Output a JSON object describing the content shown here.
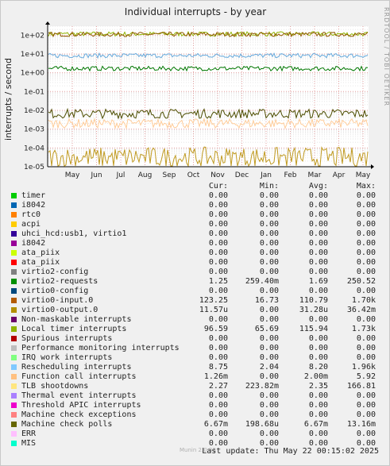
{
  "window": {
    "title": "Individual interrupts - by year"
  },
  "side_label": "RRDTOOL / TOBI OETIKER",
  "chart_data": {
    "type": "line",
    "title": "Individual interrupts - by year",
    "ylabel": "interrupts / second",
    "yscale": "log",
    "ylim": [
      1e-05,
      300
    ],
    "yticks": [
      "1e+02",
      "1e+01",
      "1e+00",
      "1e-01",
      "1e-02",
      "1e-03",
      "1e-04",
      "1e-05"
    ],
    "xticks": [
      "May",
      "Jun",
      "Jul",
      "Aug",
      "Sep",
      "Oct",
      "Nov",
      "Dec",
      "Jan",
      "Feb",
      "Mar",
      "Apr",
      "May"
    ],
    "grid": true,
    "series": [
      {
        "name": "Local timer interrupts",
        "color": "#8fb300",
        "level": 115.94
      },
      {
        "name": "virtio0-input.0",
        "color": "#8f5a00",
        "level": 110.79
      },
      {
        "name": "Rescheduling interrupts",
        "color": "#66aadd",
        "level": 8.2
      },
      {
        "name": "virtio2-requests",
        "color": "#007700",
        "level": 1.69
      },
      {
        "name": "Machine check polls",
        "color": "#4d4d00",
        "level": 0.00667
      },
      {
        "name": "Function call interrupts",
        "color": "#ffcc99",
        "level": 0.002
      },
      {
        "name": "virtio0-output.0",
        "color": "#c09a20",
        "level": 3.13e-05
      }
    ]
  },
  "legend": {
    "headers": {
      "cur": "Cur:",
      "min": "Min:",
      "avg": "Avg:",
      "max": "Max:"
    },
    "rows": [
      {
        "name": "timer",
        "color": "#00cc00",
        "cur": "0.00",
        "min": "0.00",
        "avg": "0.00",
        "max": "0.00"
      },
      {
        "name": "i8042",
        "color": "#0066b3",
        "cur": "0.00",
        "min": "0.00",
        "avg": "0.00",
        "max": "0.00"
      },
      {
        "name": "rtc0",
        "color": "#ff8000",
        "cur": "0.00",
        "min": "0.00",
        "avg": "0.00",
        "max": "0.00"
      },
      {
        "name": "acpi",
        "color": "#ffcc00",
        "cur": "0.00",
        "min": "0.00",
        "avg": "0.00",
        "max": "0.00"
      },
      {
        "name": "uhci_hcd:usb1, virtio1",
        "color": "#330099",
        "cur": "0.00",
        "min": "0.00",
        "avg": "0.00",
        "max": "0.00"
      },
      {
        "name": "i8042",
        "color": "#990099",
        "cur": "0.00",
        "min": "0.00",
        "avg": "0.00",
        "max": "0.00"
      },
      {
        "name": "ata_piix",
        "color": "#ccff00",
        "cur": "0.00",
        "min": "0.00",
        "avg": "0.00",
        "max": "0.00"
      },
      {
        "name": "ata_piix",
        "color": "#ff0000",
        "cur": "0.00",
        "min": "0.00",
        "avg": "0.00",
        "max": "0.00"
      },
      {
        "name": "virtio2-config",
        "color": "#808080",
        "cur": "0.00",
        "min": "0.00",
        "avg": "0.00",
        "max": "0.00"
      },
      {
        "name": "virtio2-requests",
        "color": "#008f00",
        "cur": "1.25",
        "min": "259.40m",
        "avg": "1.69",
        "max": "250.52"
      },
      {
        "name": "virtio0-config",
        "color": "#00487d",
        "cur": "0.00",
        "min": "0.00",
        "avg": "0.00",
        "max": "0.00"
      },
      {
        "name": "virtio0-input.0",
        "color": "#b35a00",
        "cur": "123.25",
        "min": "16.73",
        "avg": "110.79",
        "max": "1.70k"
      },
      {
        "name": "virtio0-output.0",
        "color": "#b38f00",
        "cur": "11.57u",
        "min": "0.00",
        "avg": "31.28u",
        "max": "36.42m"
      },
      {
        "name": "Non-maskable interrupts",
        "color": "#6b006b",
        "cur": "0.00",
        "min": "0.00",
        "avg": "0.00",
        "max": "0.00"
      },
      {
        "name": "Local timer interrupts",
        "color": "#8fb300",
        "cur": "96.59",
        "min": "65.69",
        "avg": "115.94",
        "max": "1.73k"
      },
      {
        "name": "Spurious interrupts",
        "color": "#b30000",
        "cur": "0.00",
        "min": "0.00",
        "avg": "0.00",
        "max": "0.00"
      },
      {
        "name": "Performance monitoring interrupts",
        "color": "#bebebe",
        "cur": "0.00",
        "min": "0.00",
        "avg": "0.00",
        "max": "0.00"
      },
      {
        "name": "IRQ work interrupts",
        "color": "#80ff80",
        "cur": "0.00",
        "min": "0.00",
        "avg": "0.00",
        "max": "0.00"
      },
      {
        "name": "Rescheduling interrupts",
        "color": "#80c9ff",
        "cur": "8.75",
        "min": "2.04",
        "avg": "8.20",
        "max": "1.96k"
      },
      {
        "name": "Function call interrupts",
        "color": "#ffc080",
        "cur": "1.26m",
        "min": "0.00",
        "avg": "2.00m",
        "max": "5.92"
      },
      {
        "name": "TLB shootdowns",
        "color": "#ffe680",
        "cur": "2.27",
        "min": "223.82m",
        "avg": "2.35",
        "max": "166.81"
      },
      {
        "name": "Thermal event interrupts",
        "color": "#aa80ff",
        "cur": "0.00",
        "min": "0.00",
        "avg": "0.00",
        "max": "0.00"
      },
      {
        "name": "Threshold APIC interrupts",
        "color": "#ee00cc",
        "cur": "0.00",
        "min": "0.00",
        "avg": "0.00",
        "max": "0.00"
      },
      {
        "name": "Machine check exceptions",
        "color": "#ff8080",
        "cur": "0.00",
        "min": "0.00",
        "avg": "0.00",
        "max": "0.00"
      },
      {
        "name": "Machine check polls",
        "color": "#666600",
        "cur": "6.67m",
        "min": "198.68u",
        "avg": "6.67m",
        "max": "13.16m"
      },
      {
        "name": "ERR",
        "color": "#ffbfff",
        "cur": "0.00",
        "min": "0.00",
        "avg": "0.00",
        "max": "0.00"
      },
      {
        "name": "MIS",
        "color": "#00ffcc",
        "cur": "0.00",
        "min": "0.00",
        "avg": "0.00",
        "max": "0.00"
      }
    ]
  },
  "footer": {
    "munin": "Munin 2.0.33",
    "last_update": "Last update: Thu May 22 00:15:02 2025"
  }
}
